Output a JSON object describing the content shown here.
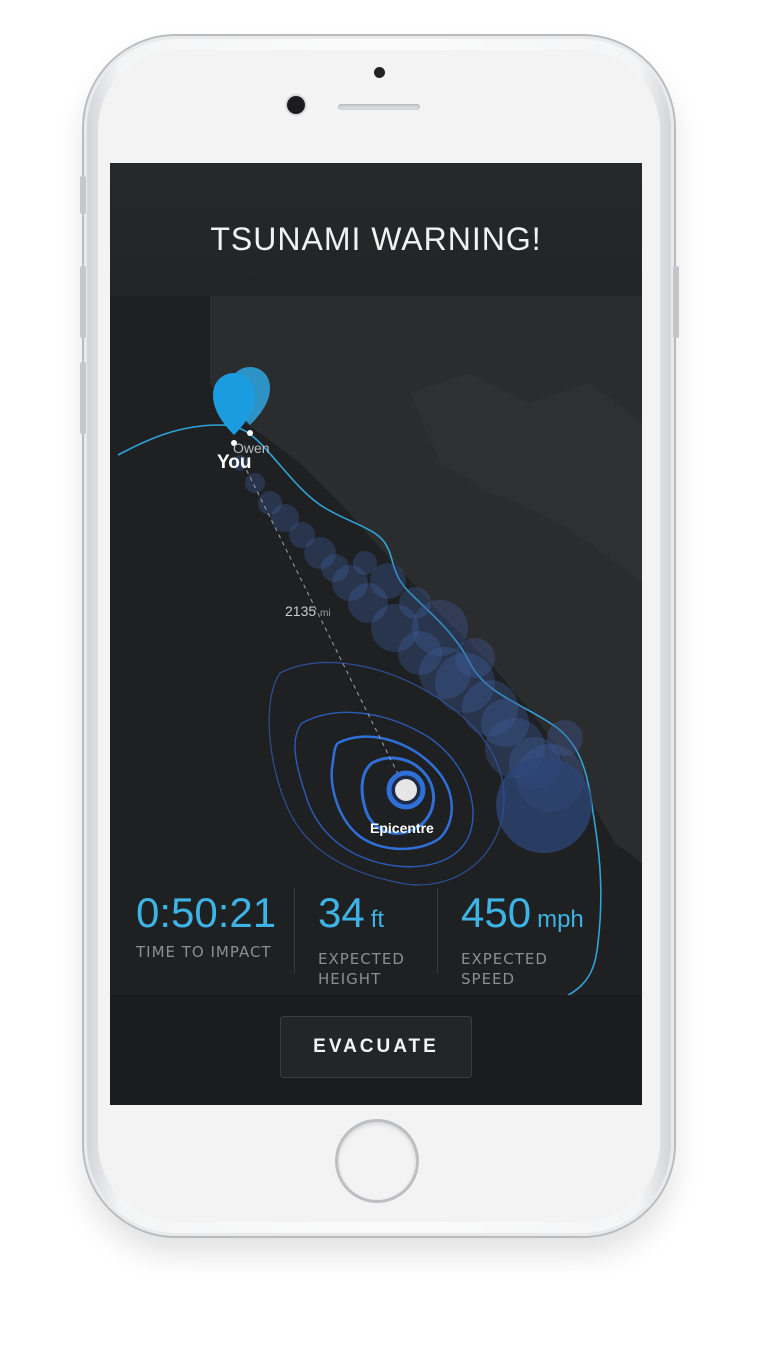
{
  "header": {
    "title": "TSUNAMI WARNING!"
  },
  "map": {
    "you_label": "You",
    "contact_label": "Owen",
    "distance_value": "2135",
    "distance_unit": "mi",
    "epicentre_label": "Epicentre"
  },
  "stats": [
    {
      "value": "0:50:21",
      "unit": "",
      "label": "TIME TO IMPACT"
    },
    {
      "value": "34",
      "unit": "ft",
      "label": "EXPECTED\nHEIGHT"
    },
    {
      "value": "450",
      "unit": "mph",
      "label": "EXPECTED\nSPEED"
    }
  ],
  "actions": {
    "evacuate_label": "EVACUATE"
  },
  "colors": {
    "accent": "#3db4e5",
    "screen_bg": "#1e2022",
    "wave_circles": "#3e5f9e",
    "epicentre": "#2f6fd8"
  },
  "icons": {
    "you_pin": "map-pin-icon",
    "contact_pin": "map-pin-icon",
    "epicentre": "target-icon"
  }
}
